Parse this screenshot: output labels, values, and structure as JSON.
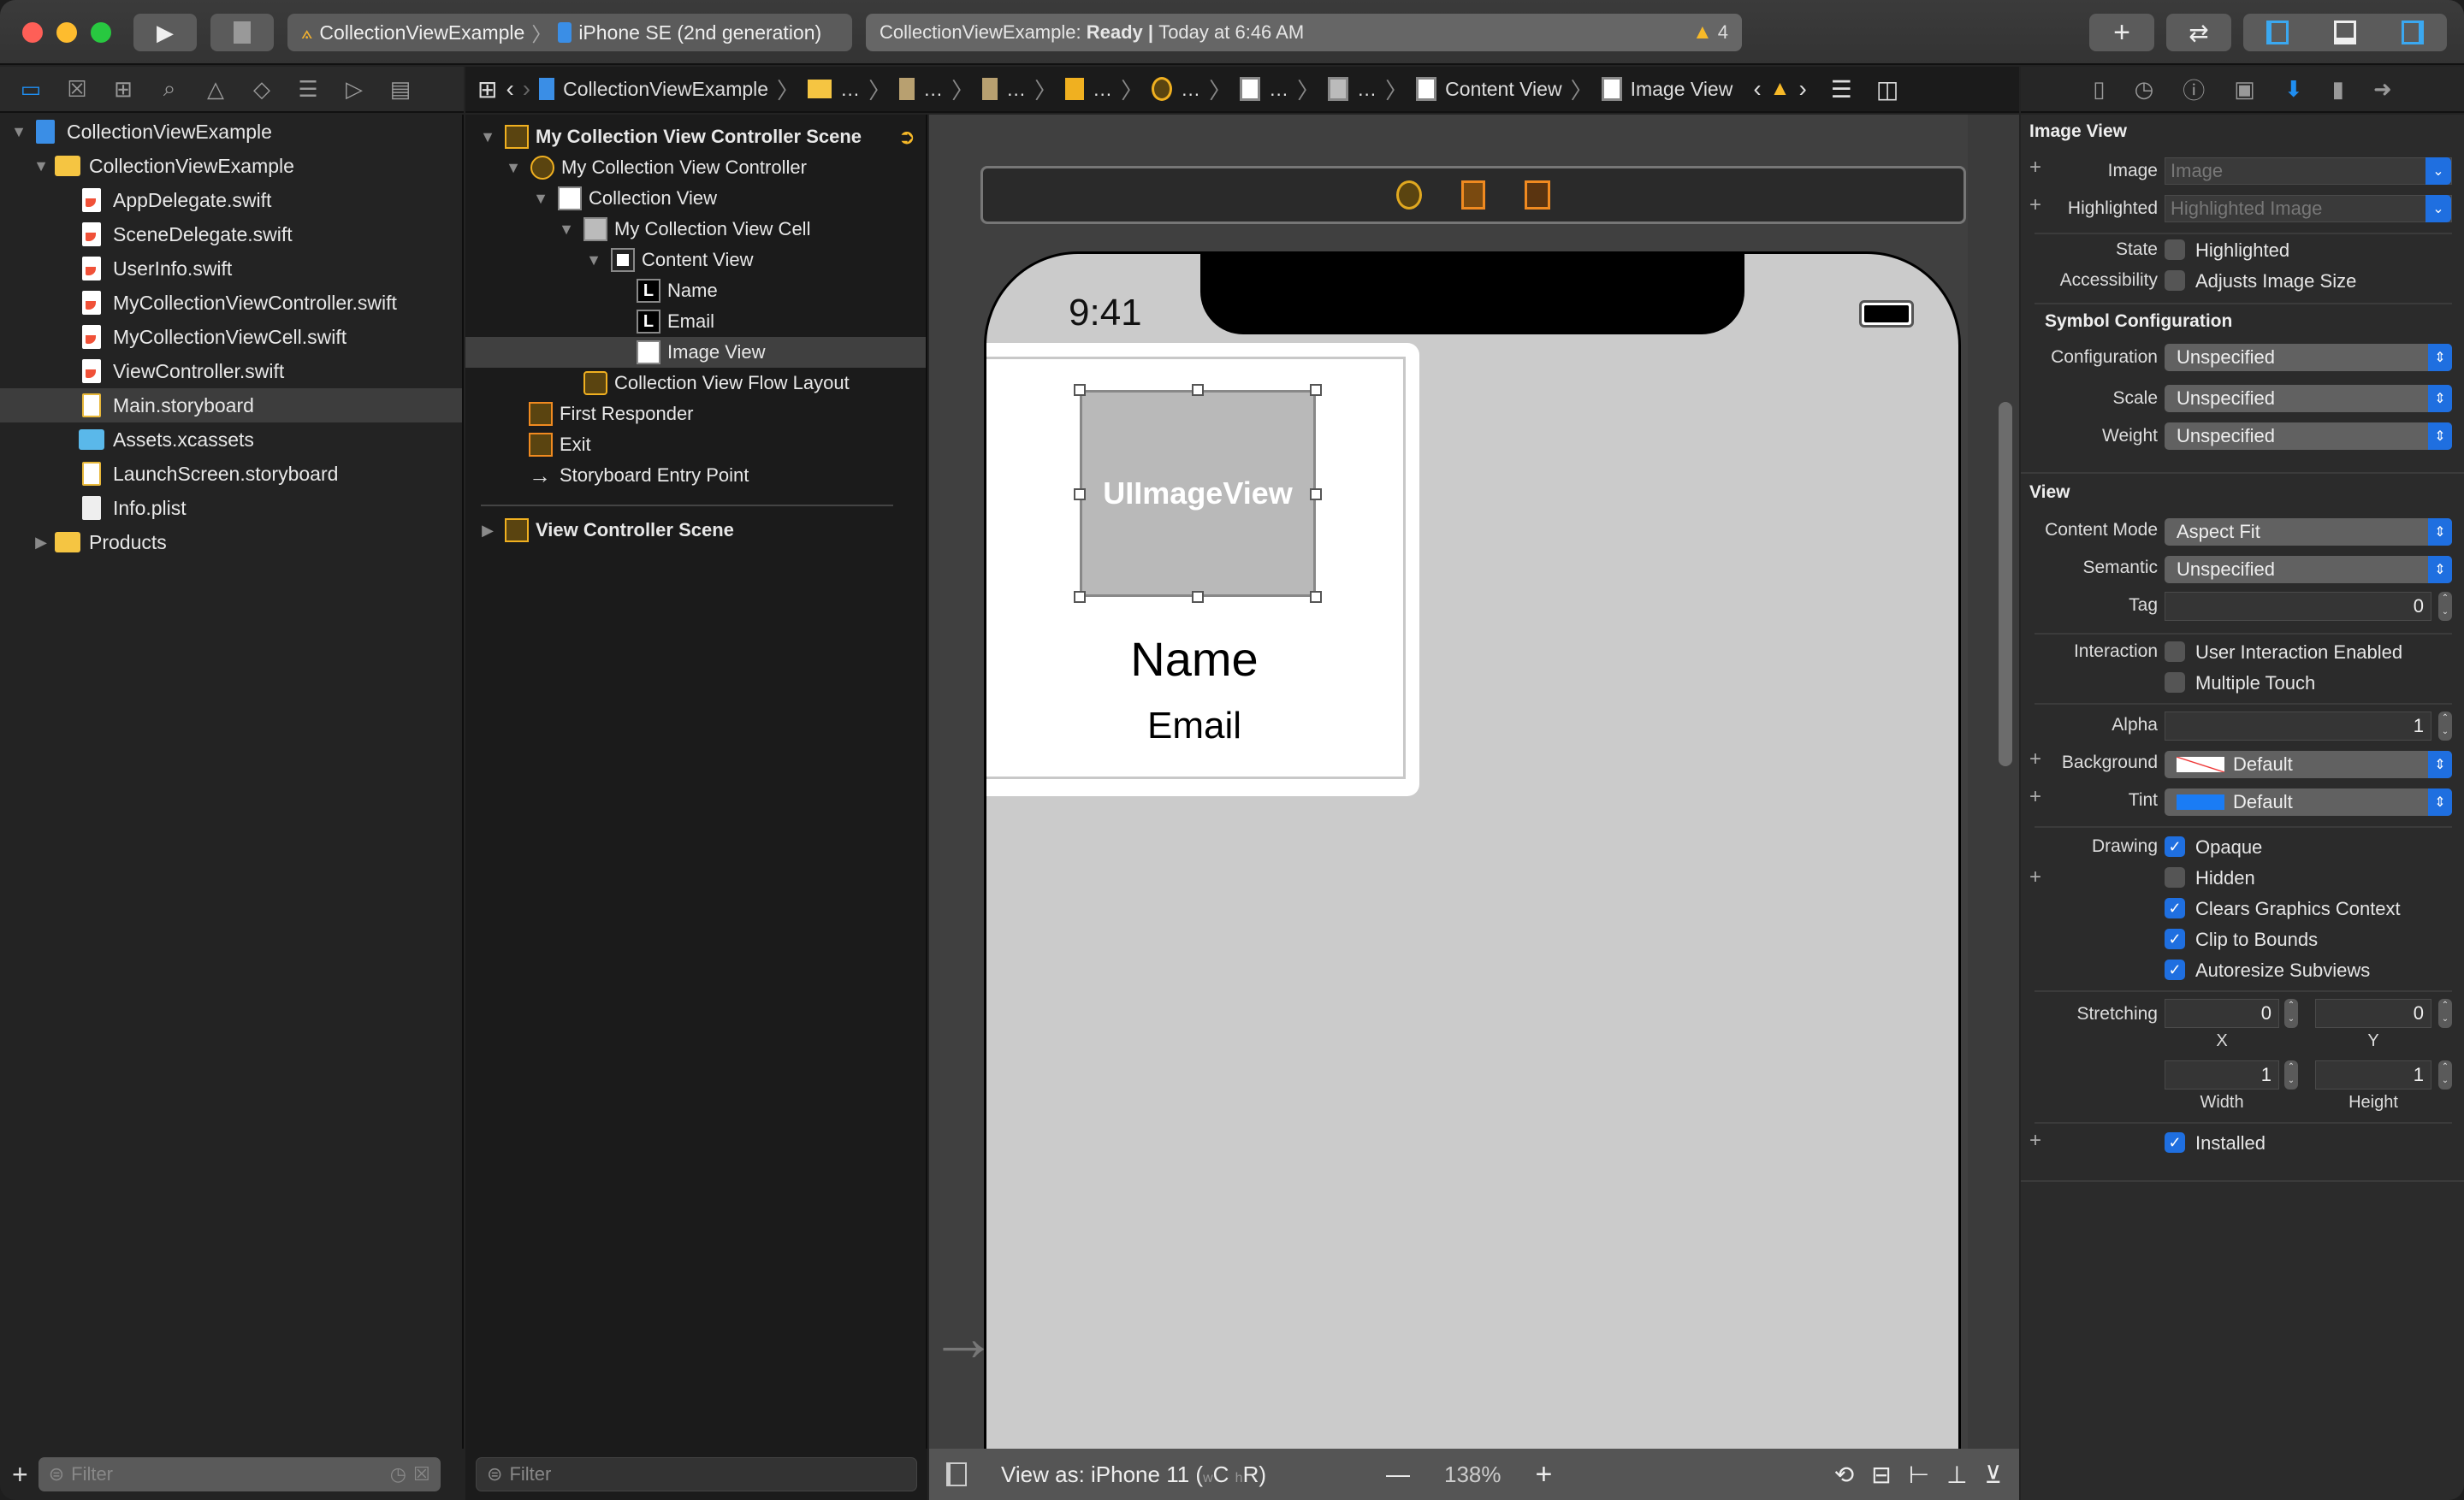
{
  "toolbar": {
    "run_label": "Run",
    "stop_label": "Stop",
    "scheme": "CollectionViewExample",
    "destination": "iPhone SE (2nd generation)",
    "status_project": "CollectionViewExample:",
    "status_state": "Ready",
    "status_sep": "|",
    "status_time": "Today at 6:46 AM",
    "warning_count": "4",
    "library_label": "+",
    "review_label": "⇄"
  },
  "navigator_tabs": [
    "project-navigator",
    "source-control",
    "symbol-navigator",
    "find-navigator",
    "issue-navigator",
    "test-navigator",
    "debug-navigator",
    "breakpoint-navigator",
    "report-navigator"
  ],
  "project_tree": [
    {
      "label": "CollectionViewExample",
      "type": "project",
      "depth": 0,
      "disclosure": "open"
    },
    {
      "label": "CollectionViewExample",
      "type": "folder",
      "depth": 1,
      "disclosure": "open"
    },
    {
      "label": "AppDelegate.swift",
      "type": "swift",
      "depth": 2
    },
    {
      "label": "SceneDelegate.swift",
      "type": "swift",
      "depth": 2
    },
    {
      "label": "UserInfo.swift",
      "type": "swift",
      "depth": 2
    },
    {
      "label": "MyCollectionViewController.swift",
      "type": "swift",
      "depth": 2
    },
    {
      "label": "MyCollectionViewCell.swift",
      "type": "swift",
      "depth": 2
    },
    {
      "label": "ViewController.swift",
      "type": "swift",
      "depth": 2
    },
    {
      "label": "Main.storyboard",
      "type": "storyboard",
      "depth": 2,
      "selected": true
    },
    {
      "label": "Assets.xcassets",
      "type": "assets",
      "depth": 2
    },
    {
      "label": "LaunchScreen.storyboard",
      "type": "storyboard",
      "depth": 2
    },
    {
      "label": "Info.plist",
      "type": "plist",
      "depth": 2
    },
    {
      "label": "Products",
      "type": "folder",
      "depth": 1,
      "disclosure": "closed"
    }
  ],
  "navigator_filter_placeholder": "Filter",
  "jumpbar": {
    "items": [
      "CollectionViewExample",
      "…",
      "…",
      "…",
      "…",
      "…",
      "…",
      "…",
      "Content View",
      "Image View"
    ]
  },
  "outline": [
    {
      "label": "My Collection View Controller Scene",
      "depth": 0,
      "disclosure": "open",
      "bold": true,
      "icon": "scene-icon"
    },
    {
      "label": "My Collection View Controller",
      "depth": 1,
      "disclosure": "open",
      "icon": "view-controller-icon"
    },
    {
      "label": "Collection View",
      "depth": 2,
      "disclosure": "open",
      "icon": "collection-view-icon"
    },
    {
      "label": "My Collection View Cell",
      "depth": 3,
      "disclosure": "open",
      "icon": "collection-cell-icon"
    },
    {
      "label": "Content View",
      "depth": 4,
      "disclosure": "open",
      "icon": "content-view-icon"
    },
    {
      "label": "Name",
      "depth": 5,
      "icon": "label-icon"
    },
    {
      "label": "Email",
      "depth": 5,
      "icon": "label-icon"
    },
    {
      "label": "Image View",
      "depth": 5,
      "icon": "image-view-icon",
      "selected": true
    },
    {
      "label": "Collection View Flow Layout",
      "depth": 3,
      "icon": "flow-layout-icon"
    },
    {
      "label": "First Responder",
      "depth": 1,
      "icon": "first-responder-icon"
    },
    {
      "label": "Exit",
      "depth": 1,
      "icon": "exit-icon"
    },
    {
      "label": "Storyboard Entry Point",
      "depth": 1,
      "icon": "entry-arrow-icon"
    }
  ],
  "outline_scene2": "View Controller Scene",
  "outline_filter_placeholder": "Filter",
  "canvas": {
    "time": "9:41",
    "image_view_placeholder": "UIImageView",
    "name_label": "Name",
    "email_label": "Email",
    "view_as": "View as: iPhone 11 (",
    "size_w": "w",
    "size_C": "C",
    "size_h": "h",
    "size_R": "R)",
    "zoom_minus": "—",
    "zoom_level": "138%",
    "zoom_plus": "+"
  },
  "inspector": {
    "image_view_title": "Image View",
    "image_label": "Image",
    "image_placeholder": "Image",
    "highlighted_label": "Highlighted",
    "highlighted_placeholder": "Highlighted Image",
    "state_label": "State",
    "state_option": "Highlighted",
    "state_checked": false,
    "accessibility_label": "Accessibility",
    "accessibility_option": "Adjusts Image Size",
    "accessibility_checked": false,
    "symbol_title": "Symbol Configuration",
    "configuration_label": "Configuration",
    "configuration_value": "Unspecified",
    "scale_label": "Scale",
    "scale_value": "Unspecified",
    "weight_label": "Weight",
    "weight_value": "Unspecified",
    "view_title": "View",
    "content_mode_label": "Content Mode",
    "content_mode_value": "Aspect Fit",
    "semantic_label": "Semantic",
    "semantic_value": "Unspecified",
    "tag_label": "Tag",
    "tag_value": "0",
    "interaction_label": "Interaction",
    "user_interaction": "User Interaction Enabled",
    "user_interaction_checked": false,
    "multiple_touch": "Multiple Touch",
    "multiple_touch_checked": false,
    "alpha_label": "Alpha",
    "alpha_value": "1",
    "background_label": "Background",
    "background_value": "Default",
    "tint_label": "Tint",
    "tint_value": "Default",
    "tint_color": "#1a7cf5",
    "drawing_label": "Drawing",
    "opaque": "Opaque",
    "hidden": "Hidden",
    "clears": "Clears Graphics Context",
    "clip": "Clip to Bounds",
    "autoresize": "Autoresize Subviews",
    "drawing_checked": {
      "opaque": true,
      "hidden": false,
      "clears": true,
      "clip": true,
      "autoresize": true
    },
    "stretching_label": "Stretching",
    "stretch_x": "0",
    "stretch_y": "0",
    "stretch_w": "1",
    "stretch_h": "1",
    "x_label": "X",
    "y_label": "Y",
    "width_label": "Width",
    "height_label": "Height",
    "installed": "Installed",
    "installed_checked": true
  },
  "colors": {
    "accent": "#1f6fe0",
    "warning": "#f7b928",
    "selection": "#3d3d3d"
  }
}
